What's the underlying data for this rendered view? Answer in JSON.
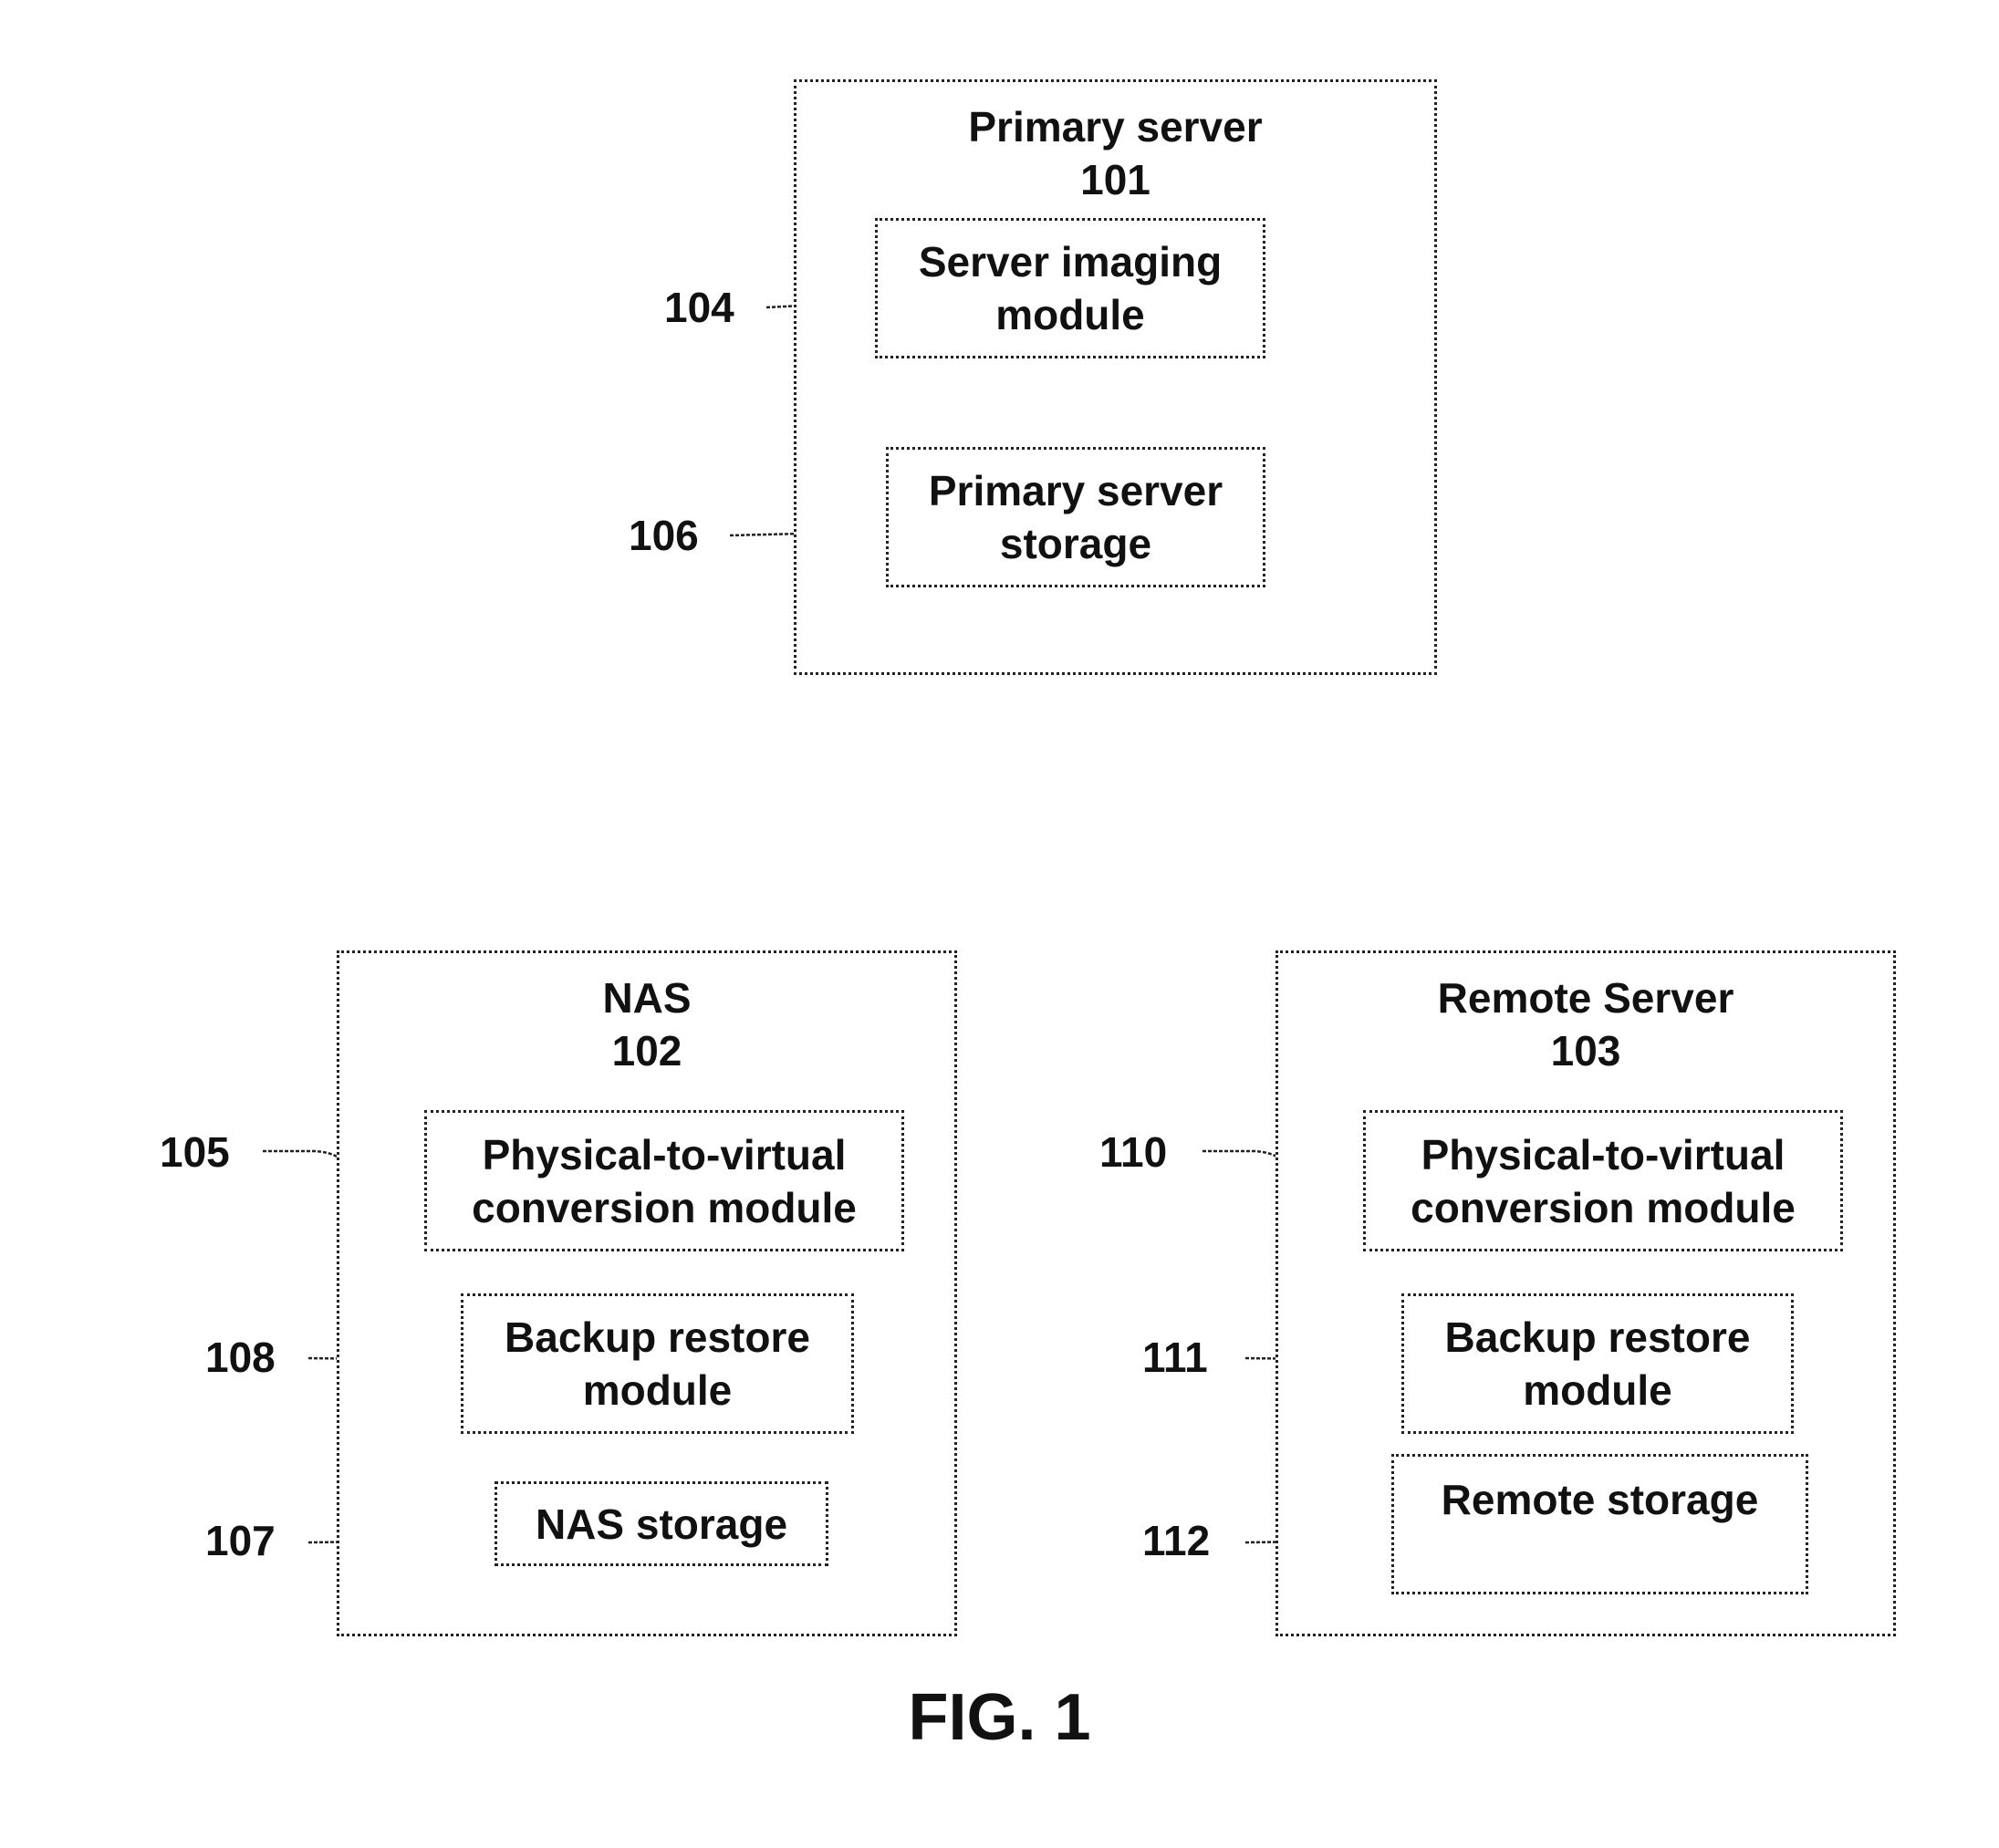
{
  "figure": {
    "caption": "FIG. 1"
  },
  "primary_server": {
    "title": "Primary server",
    "number": "101",
    "modules": [
      {
        "label_lines": [
          "Server imaging",
          "module"
        ],
        "ref": "104"
      },
      {
        "label_lines": [
          "Primary server",
          "storage"
        ],
        "ref": "106"
      }
    ]
  },
  "nas": {
    "title": "NAS",
    "number": "102",
    "modules": [
      {
        "label_lines": [
          "Physical-to-virtual",
          "conversion module"
        ],
        "ref": "105"
      },
      {
        "label_lines": [
          "Backup restore",
          "module"
        ],
        "ref": "108"
      },
      {
        "label_lines": [
          "NAS storage"
        ],
        "ref": "107"
      }
    ]
  },
  "remote_server": {
    "title": "Remote Server",
    "number": "103",
    "modules": [
      {
        "label_lines": [
          "Physical-to-virtual",
          "conversion module"
        ],
        "ref": "110"
      },
      {
        "label_lines": [
          "Backup restore",
          "module"
        ],
        "ref": "111"
      },
      {
        "label_lines": [
          "Remote storage"
        ],
        "ref": "112"
      }
    ]
  }
}
